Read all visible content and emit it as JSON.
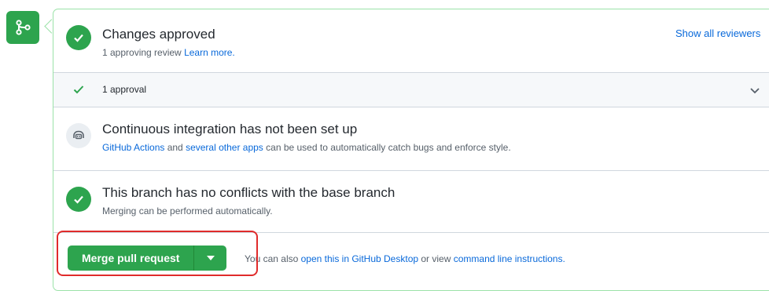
{
  "review": {
    "title": "Changes approved",
    "subtitle_prefix": "1 approving review ",
    "learn_more": "Learn more.",
    "show_all": "Show all reviewers"
  },
  "approval_row": {
    "label": "1 approval"
  },
  "ci": {
    "title": "Continuous integration has not been set up",
    "link1": "GitHub Actions",
    "text1": " and ",
    "link2": "several other apps",
    "text2": " can be used to automatically catch bugs and enforce style."
  },
  "conflicts": {
    "title": "This branch has no conflicts with the base branch",
    "subtitle": "Merging can be performed automatically."
  },
  "merge": {
    "button_label": "Merge pull request",
    "hint_prefix": "You can also ",
    "hint_link1": "open this in GitHub Desktop",
    "hint_mid": " or view ",
    "hint_link2": "command line instructions."
  },
  "colors": {
    "success": "#2da44e",
    "link": "#0969da",
    "highlight": "#e02b2b"
  },
  "icons": [
    "git-merge-icon",
    "check-circle-icon",
    "check-icon",
    "chevron-down-icon",
    "ci-bot-icon",
    "caret-down-icon"
  ]
}
